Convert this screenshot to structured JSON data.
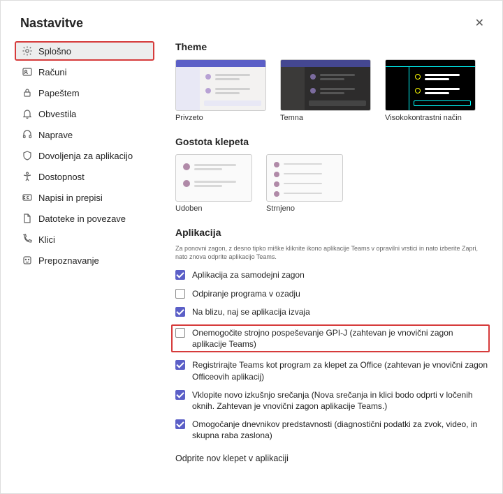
{
  "title": "Nastavitve",
  "sidebar": {
    "items": [
      {
        "label": "Splošno"
      },
      {
        "label": "Računi"
      },
      {
        "label": "Papeštem"
      },
      {
        "label": "Obvestila"
      },
      {
        "label": "Naprave"
      },
      {
        "label": "Dovoljenja za aplikacijo"
      },
      {
        "label": "Dostopnost"
      },
      {
        "label": "Napisi in prepisi"
      },
      {
        "label": "Datoteke in povezave"
      },
      {
        "label": "Klici"
      },
      {
        "label": "Prepoznavanje"
      }
    ]
  },
  "theme": {
    "heading": "Theme",
    "options": [
      {
        "label": "Privzeto"
      },
      {
        "label": "Temna"
      },
      {
        "label": "Visokokontrastni način"
      }
    ]
  },
  "density": {
    "heading": "Gostota klepeta",
    "options": [
      {
        "label": "Udoben"
      },
      {
        "label": "Strnjeno"
      }
    ]
  },
  "app": {
    "heading": "Aplikacija",
    "note": "Za ponovni zagon, z desno tipko miške kliknite ikono aplikacije Teams v opravilni vrstici in nato izberite Zapri, nato znova odprite aplikacijo Teams.",
    "checks": [
      {
        "checked": true,
        "label": "Aplikacija za samodejni zagon"
      },
      {
        "checked": false,
        "label": "Odpiranje programa v ozadju"
      },
      {
        "checked": true,
        "label": "Na blizu, naj se aplikacija izvaja"
      },
      {
        "checked": false,
        "label": "Onemogočite strojno pospeševanje GPI-J (zahtevan je vnovični zagon aplikacije Teams)",
        "highlight": true
      },
      {
        "checked": true,
        "label": "Registrirajte Teams kot program za klepet za Office (zahtevan je vnovični zagon Officeovih aplikacij)"
      },
      {
        "checked": true,
        "label": "Vklopite novo izkušnjo srečanja (Nova srečanja in klici bodo odprti v ločenih oknih. Zahtevan je vnovični zagon aplikacije Teams.)"
      },
      {
        "checked": true,
        "label": "Omogočanje dnevnikov predstavnosti (diagnostični podatki za zvok, video, in skupna raba zaslona)"
      }
    ]
  },
  "chat_open_heading": "Odprite nov klepet v aplikaciji"
}
